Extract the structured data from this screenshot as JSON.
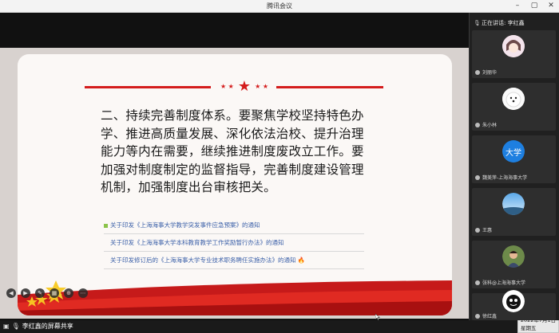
{
  "app": {
    "title": "腾讯会议"
  },
  "window": {
    "minimize": "–",
    "maximize": "▢",
    "close": "✕"
  },
  "slide": {
    "body_text": "二、持续完善制度体系。要聚焦学校坚持特色办学、推进高质量发展、深化依法治校、提升治理能力等内在需要，继续推进制度废改立工作。要加强对制度制定的监督指导，完善制度建设管理机制，加强制度出台审核把关。",
    "links": [
      {
        "text": "关于印发《上海海事大学教学突发事件应急预案》的通知"
      },
      {
        "text": "关于印发《上海海事大学本科教育教学工作奖励暂行办法》的通知"
      },
      {
        "text": "关于印发修订后的《上海海事大学专业技术职务聘任实施办法》的通知"
      }
    ],
    "colors": {
      "accent_red": "#d41c1c",
      "link": "#3a5fa8"
    }
  },
  "sharing": {
    "label": "李红鑫的屏幕共享"
  },
  "speaker": {
    "label": "正在讲话: 李红鑫"
  },
  "participants": [
    {
      "name": "刘丽华",
      "avatar": "anime-avatar"
    },
    {
      "name": "朱小林",
      "avatar": "white-dog-avatar"
    },
    {
      "name": "魏美萍-上海海事大学",
      "avatar": "text-avatar",
      "avatar_text": "大学",
      "avatar_color": "#1e7fe0"
    },
    {
      "name": "王惠",
      "avatar": "landscape-avatar"
    },
    {
      "name": "张科@上海海事大学",
      "avatar": "photo-avatar"
    },
    {
      "name": "徐红鑫",
      "avatar": "cartoon-avatar"
    }
  ],
  "clock": {
    "date": "2022年7月1日",
    "weekday": "星期五"
  }
}
